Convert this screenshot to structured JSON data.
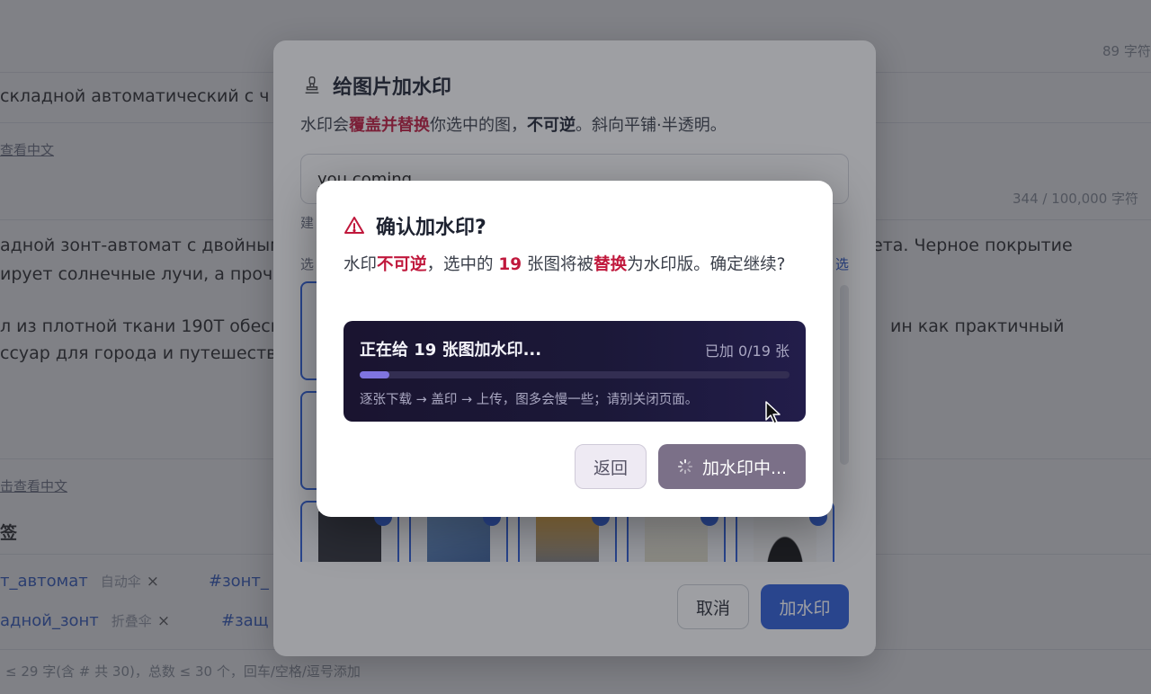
{
  "background": {
    "count_top": "89 字符",
    "title_line": "складной автоматический с ч",
    "view_cn_1": "查看中文",
    "char_count": "344 / 100,000 字符",
    "para1a": "адной зонт-автомат с двойным",
    "para1b": "ета. Черное покрытие",
    "para2": "ирует солнечные лучи, а прочн",
    "para3a": "л из плотной ткани 190T обесп",
    "para3b": "ин как практичный",
    "para4": "ссуар для города и путешестви",
    "view_cn_2": "击查看中文",
    "tags_label": "签",
    "tags": [
      {
        "text": "т_автомат",
        "sub": "自动伞",
        "x": "×"
      },
      {
        "text": "#зонт_",
        "sub": "",
        "x": ""
      },
      {
        "text": "адной_зонт",
        "sub": "折叠伞",
        "x": "×"
      },
      {
        "text": "#защ",
        "sub": "",
        "x": ""
      }
    ],
    "footer_hint": "≤ 29 字(含 # 共 30)，总数 ≤ 30 个，回车/空格/逗号添加"
  },
  "watermark_modal": {
    "title": "给图片加水印",
    "desc_part1": "水印会",
    "desc_red": "覆盖并替换",
    "desc_part2": "你选中的图，",
    "desc_bold": "不可逆",
    "desc_part3": "。斜向平铺·半透明。",
    "input_value": "you coming",
    "hint_1": "建",
    "hint_2": "选",
    "select_link": "选",
    "cancel_label": "取消",
    "confirm_label": "加水印"
  },
  "confirm_dialog": {
    "title": "确认加水印?",
    "body_1": "水印",
    "body_red_1": "不可逆",
    "body_2": "，选中的 ",
    "body_count": "19",
    "body_3": " 张图将被",
    "body_red_2": "替换",
    "body_4": "为水印版。确定继续?",
    "progress": {
      "title": "正在给 19 张图加水印...",
      "count": "已加 0/19 张",
      "value_fraction": 0.07,
      "note": "逐张下载 → 盖印 → 上传，图多会慢一些；请别关闭页面。"
    },
    "back_label": "返回",
    "working_label": "加水印中..."
  },
  "colors": {
    "accent": "#2b5bd7",
    "danger": "#c0183c",
    "progress_bg": "#1b1838",
    "progress_fill": "#7f74e0"
  }
}
